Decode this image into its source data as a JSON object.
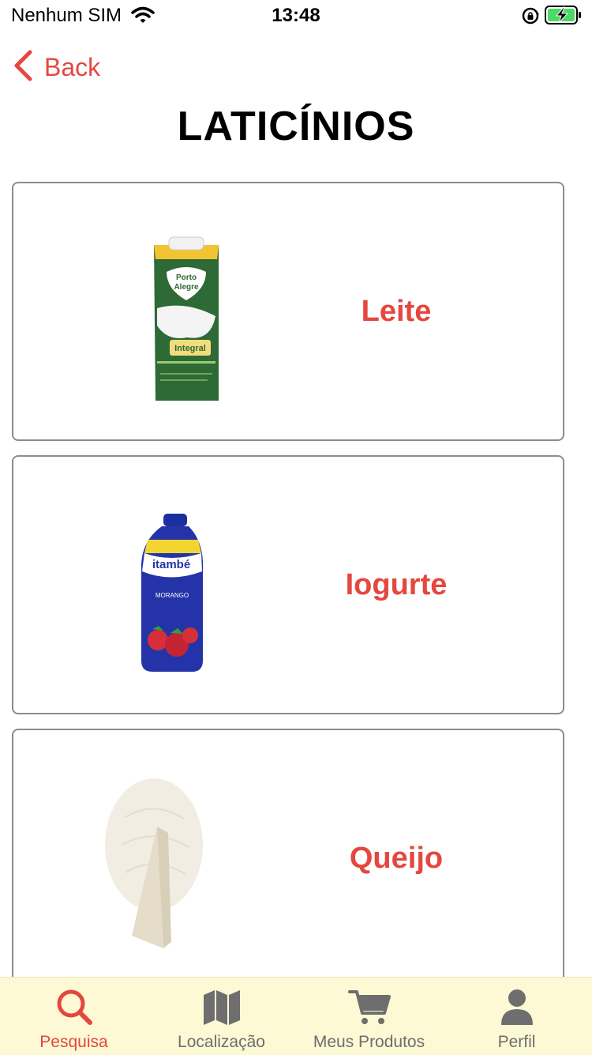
{
  "status_bar": {
    "carrier": "Nenhum SIM",
    "time": "13:48"
  },
  "nav": {
    "back_label": "Back"
  },
  "page": {
    "title": "LATICÍNIOS"
  },
  "products": [
    {
      "name": "Leite",
      "image_icon": "milk-carton-icon"
    },
    {
      "name": "Iogurte",
      "image_icon": "yogurt-bottle-icon"
    },
    {
      "name": "Queijo",
      "image_icon": "cheese-icon"
    }
  ],
  "tabs": [
    {
      "label": "Pesquisa",
      "icon": "search-icon",
      "active": true
    },
    {
      "label": "Localização",
      "icon": "map-icon",
      "active": false
    },
    {
      "label": "Meus Produtos",
      "icon": "cart-icon",
      "active": false
    },
    {
      "label": "Perfil",
      "icon": "user-icon",
      "active": false
    }
  ],
  "colors": {
    "accent": "#e4473f",
    "tab_bar_bg": "#fdf9d4",
    "tab_inactive": "#6e6e6e",
    "card_border": "#8c8c8c"
  }
}
